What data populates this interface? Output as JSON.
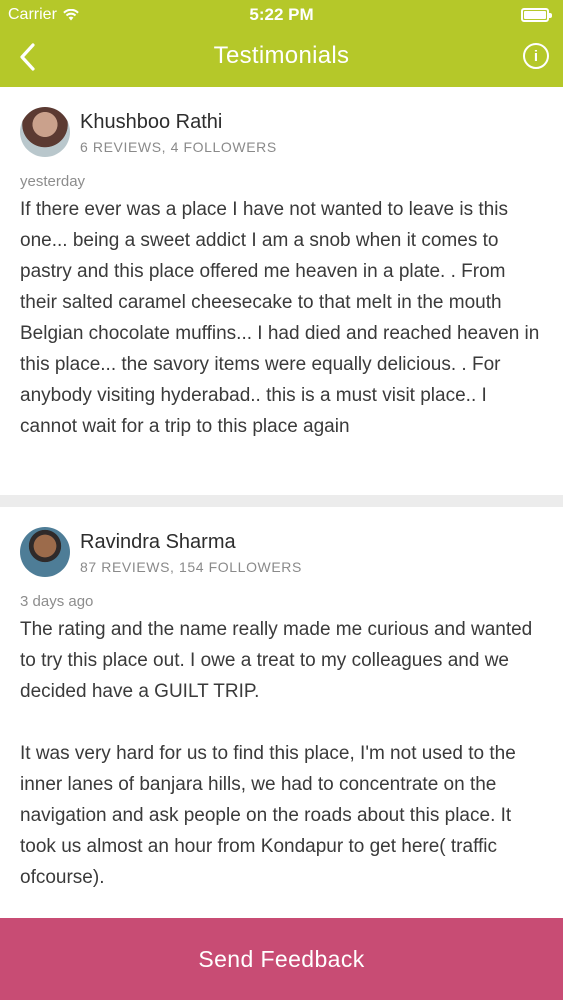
{
  "status_bar": {
    "carrier": "Carrier",
    "time": "5:22 PM",
    "wifi_icon": "wifi-icon",
    "battery_icon": "battery-icon"
  },
  "nav": {
    "back_icon": "chevron-left-icon",
    "title": "Testimonials",
    "info_icon": "info-icon",
    "info_glyph": "i"
  },
  "colors": {
    "header_bg": "#b5c829",
    "button_bg": "#c84c74",
    "separator": "#ececec"
  },
  "reviews": [
    {
      "name": "Khushboo Rathi",
      "stats": "6 REVIEWS, 4 FOLLOWERS",
      "date": "yesterday",
      "text": "If there ever was a place I have not wanted to leave is this one... being a sweet addict I am a snob when it comes to pastry and this place offered me heaven in a plate. . From their salted caramel cheesecake to that melt in the mouth Belgian chocolate muffins... I had died and reached heaven in this place... the savory items were equally delicious. . For anybody visiting hyderabad.. this is a must visit place.. I cannot wait for a trip to this place again"
    },
    {
      "name": "Ravindra Sharma",
      "stats": "87 REVIEWS, 154 FOLLOWERS",
      "date": "3 days ago",
      "text": "The rating and the name really made me curious and wanted to try this place out. I owe a treat to my colleagues and we decided have a GUILT TRIP.\n\nIt was very hard for us to find this place, I'm not used to the inner lanes of banjara hills, we had to concentrate on the navigation and ask people on the roads about this place. It took us almost an hour from Kondapur to get here( traffic ofcourse)."
    }
  ],
  "footer": {
    "send_feedback_label": "Send Feedback"
  }
}
